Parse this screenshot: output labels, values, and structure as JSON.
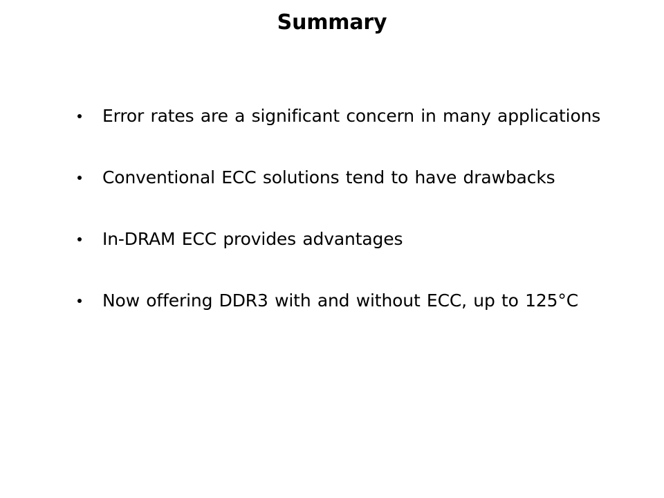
{
  "slide": {
    "background_color": "#ffffff",
    "text_color": "#000000",
    "title": "Summary",
    "bullet_marker_glyph": "•",
    "bullets": [
      {
        "text": "Error rates are a significant concern in many applications"
      },
      {
        "text": "Conventional ECC solutions tend to have drawbacks"
      },
      {
        "text": "In-DRAM ECC provides advantages"
      },
      {
        "text": "Now offering DDR3 with and without ECC, up to 125°C"
      }
    ]
  }
}
